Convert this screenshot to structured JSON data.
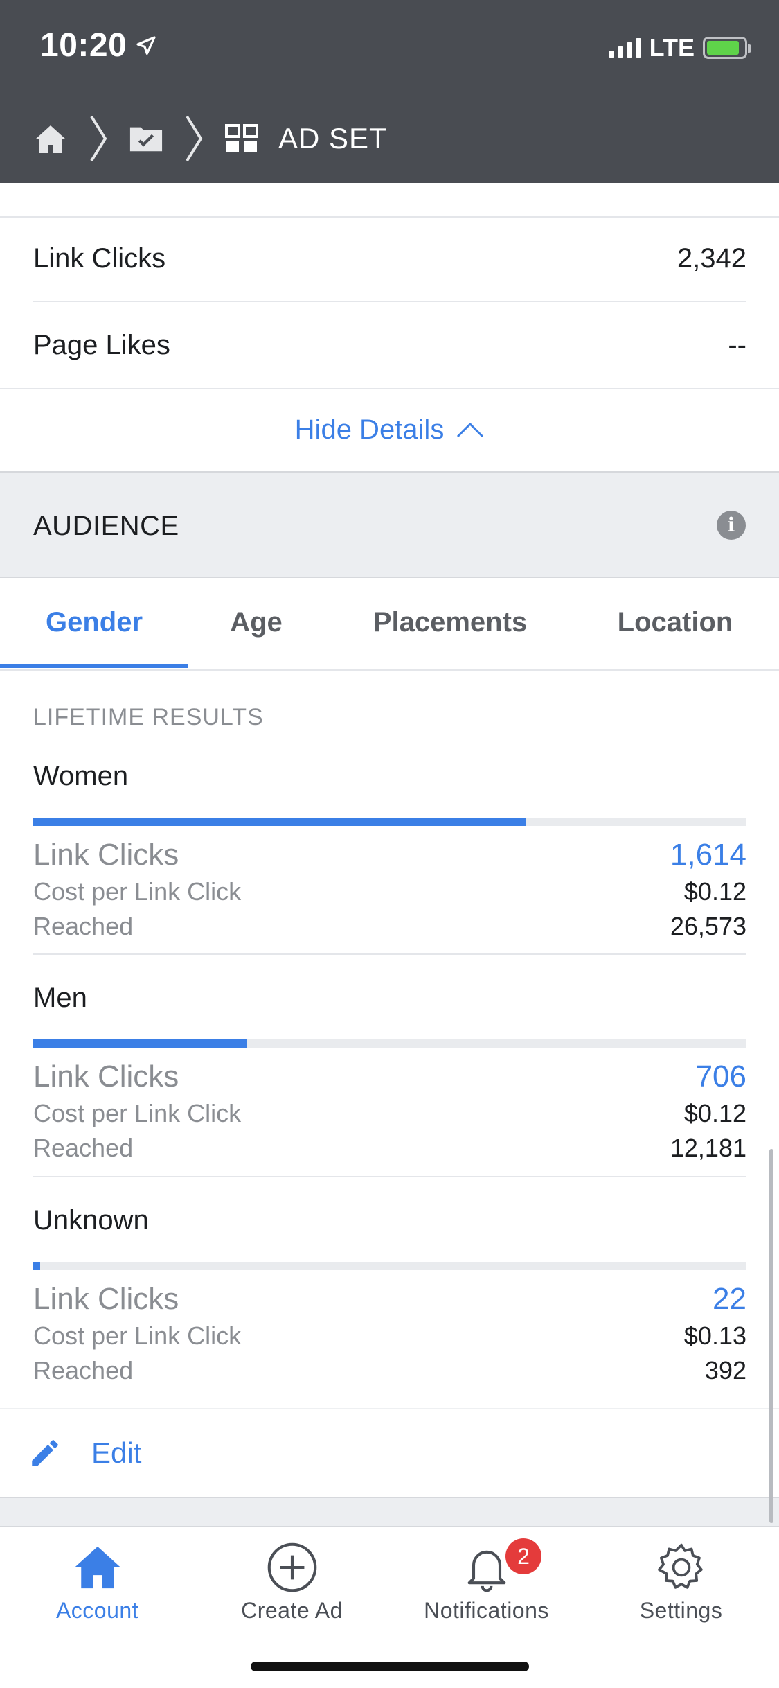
{
  "status_bar": {
    "time": "10:20",
    "network": "LTE"
  },
  "breadcrumb": {
    "current": "AD SET"
  },
  "metrics": [
    {
      "label": "Link Clicks",
      "value": "2,342"
    },
    {
      "label": "Page Likes",
      "value": "--"
    }
  ],
  "hide_details": "Hide Details",
  "audience": {
    "title": "AUDIENCE",
    "tabs": [
      "Gender",
      "Age",
      "Placements",
      "Location"
    ],
    "active_tab": "Gender",
    "results_heading": "LIFETIME RESULTS",
    "groups": [
      {
        "name": "Women",
        "bar_fraction": 0.69,
        "link_clicks_label": "Link Clicks",
        "link_clicks": "1,614",
        "cost_label": "Cost per Link Click",
        "cost": "$0.12",
        "reached_label": "Reached",
        "reached": "26,573"
      },
      {
        "name": "Men",
        "bar_fraction": 0.3,
        "link_clicks_label": "Link Clicks",
        "link_clicks": "706",
        "cost_label": "Cost per Link Click",
        "cost": "$0.12",
        "reached_label": "Reached",
        "reached": "12,181"
      },
      {
        "name": "Unknown",
        "bar_fraction": 0.01,
        "link_clicks_label": "Link Clicks",
        "link_clicks": "22",
        "cost_label": "Cost per Link Click",
        "cost": "$0.13",
        "reached_label": "Reached",
        "reached": "392"
      }
    ]
  },
  "edit_label": "Edit",
  "tabbar": {
    "items": [
      {
        "label": "Account",
        "icon": "home-icon",
        "active": true
      },
      {
        "label": "Create Ad",
        "icon": "plus-circle-icon",
        "active": false
      },
      {
        "label": "Notifications",
        "icon": "bell-icon",
        "active": false,
        "badge": "2"
      },
      {
        "label": "Settings",
        "icon": "gear-icon",
        "active": false
      }
    ]
  },
  "colors": {
    "accent": "#3b7fe6",
    "header": "#494c52",
    "badge": "#e43b3b"
  }
}
